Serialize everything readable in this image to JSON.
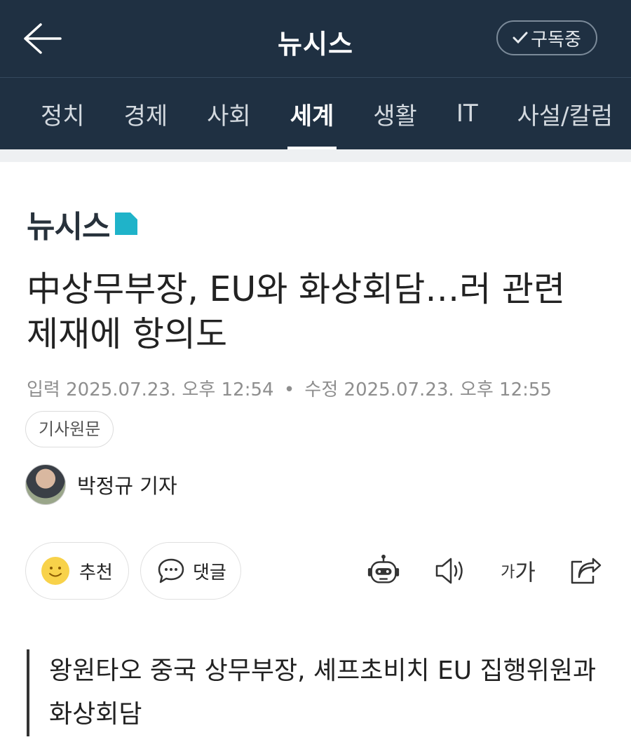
{
  "header": {
    "title": "뉴시스",
    "subscribe_label": "구독중"
  },
  "tabs": [
    {
      "label": "정치",
      "active": false
    },
    {
      "label": "경제",
      "active": false
    },
    {
      "label": "사회",
      "active": false
    },
    {
      "label": "세계",
      "active": true
    },
    {
      "label": "생활",
      "active": false
    },
    {
      "label": "IT",
      "active": false
    },
    {
      "label": "사설/칼럼",
      "active": false
    }
  ],
  "article": {
    "publisher_logo": "뉴시스",
    "headline": "中상무부장, EU와 화상회담…러 관련 제재에 항의도",
    "published_label": "입력",
    "published": "2025.07.23. 오후 12:54",
    "modified_label": "수정",
    "modified": "2025.07.23. 오후 12:55",
    "original_button": "기사원문",
    "author": "박정규 기자",
    "summary": "왕원타오 중국 상무부장, 셰프초비치 EU 집행위원과 화상회담"
  },
  "actions": {
    "recommend_label": "추천",
    "comment_label": "댓글",
    "font_small": "가",
    "font_large": "가"
  },
  "colors": {
    "header_bg": "#1f3042",
    "accent_logo": "#1fb3c9"
  }
}
